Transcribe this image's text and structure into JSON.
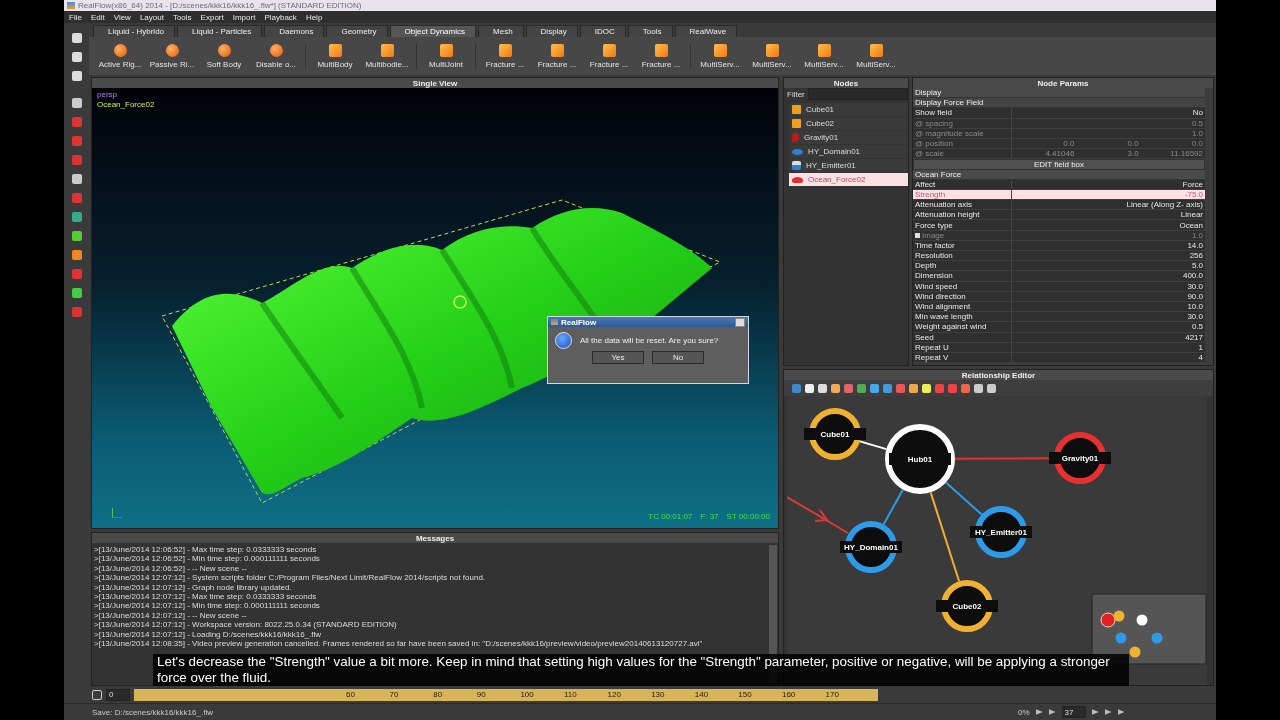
{
  "window": {
    "title": "RealFlow(x86_64) 2014 - [D:/scenes/kkk16/kkk16_.flw*] (STANDARD EDITION)"
  },
  "menu": [
    "File",
    "Edit",
    "View",
    "Layout",
    "Tools",
    "Export",
    "Import",
    "Playback",
    "Help"
  ],
  "shelf_tabs": [
    {
      "label": "Liquid - Hybrido",
      "selected": false
    },
    {
      "label": "Liquid - Particles",
      "selected": false
    },
    {
      "label": "Daemons",
      "selected": false
    },
    {
      "label": "Geometry",
      "selected": false
    },
    {
      "label": "Object Dynamics",
      "selected": true
    },
    {
      "label": "Mesh",
      "selected": false
    },
    {
      "label": "Display",
      "selected": false
    },
    {
      "label": "IDOC",
      "selected": false
    },
    {
      "label": "Tools",
      "selected": false
    },
    {
      "label": "RealWave",
      "selected": false
    }
  ],
  "shelf_groups": [
    [
      "Active Rig...",
      "Passive Ri...",
      "Soft Body",
      "Disable o..."
    ],
    [
      "MultiBody",
      "Multibodie..."
    ],
    [
      "MultiJoint"
    ],
    [
      "Fracture ...",
      "Fracture ...",
      "Fracture ...",
      "Fracture ..."
    ],
    [
      "MultiServ...",
      "MultiServ...",
      "MultiServ...",
      "MultiServ..."
    ]
  ],
  "viewport": {
    "title": "Single View",
    "camera": "persp",
    "object": "Ocean_Force02",
    "timecode": "TC 00:01:07",
    "frame": "F: 37",
    "sim_time": "ST 00:00:00"
  },
  "dialog": {
    "title": "RealFlow",
    "message": "All the data will be reset. Are you sure?",
    "buttons": [
      "Yes",
      "No"
    ]
  },
  "messages": {
    "title": "Messages",
    "lines": [
      ">[13/June/2014 12:06:52] - Max time step: 0.0333333 seconds",
      ">[13/June/2014 12:06:52] - Min time step: 0.000111111 seconds",
      ">[13/June/2014 12:06:52] - -- New scene --",
      ">[13/June/2014 12:07:12] - System scripts folder C:/Program Files/Next Limit/RealFlow 2014/scripts not found.",
      ">[13/June/2014 12:07:12] - Graph node library updated.",
      ">[13/June/2014 12:07:12] - Max time step: 0.0333333 seconds",
      ">[13/June/2014 12:07:12] - Min time step: 0.000111111 seconds",
      ">[13/June/2014 12:07:12] - -- New scene --",
      ">[13/June/2014 12:07:12] - Workspace version: 8022.25.0.34 (STANDARD EDITION)",
      ">[13/June/2014 12:07:12] -  Loading D:/scenes/kkk16/kkk16_.flw",
      ">[13/June/2014 12:08:35] - Video preview generation cancelled. Frames rendered so far have been saved in: \"D:/scenes/kkk16/preview/video/preview20140613120727.avi\""
    ]
  },
  "nodes": {
    "title": "Nodes",
    "filter_label": "Filter",
    "items": [
      {
        "name": "Cube01",
        "kind": "cube",
        "selected": false
      },
      {
        "name": "Cube02",
        "kind": "cube",
        "selected": false
      },
      {
        "name": "Gravity01",
        "kind": "gravity",
        "selected": false
      },
      {
        "name": "HY_Domain01",
        "kind": "domain",
        "selected": false
      },
      {
        "name": "HY_Emitter01",
        "kind": "emitter",
        "selected": false
      },
      {
        "name": "Ocean_Force02",
        "kind": "ocean",
        "selected": true
      }
    ]
  },
  "node_params": {
    "title": "Node Params",
    "rows": [
      {
        "kind": "section",
        "label": "Display"
      },
      {
        "kind": "subsection",
        "label": "Display Force Field"
      },
      {
        "kind": "param",
        "label": "Show field",
        "values": [
          "No"
        ],
        "disabled": false,
        "selected": false
      },
      {
        "kind": "param",
        "label": "@ spacing",
        "values": [
          "0.5"
        ],
        "disabled": true,
        "selected": false
      },
      {
        "kind": "param",
        "label": "@ magnitude scale",
        "values": [
          "1.0"
        ],
        "disabled": true,
        "selected": false
      },
      {
        "kind": "param",
        "label": "@ position",
        "values": [
          "0.0",
          "0.0",
          "0.0"
        ],
        "disabled": true,
        "selected": false
      },
      {
        "kind": "param",
        "label": "@ scale",
        "values": [
          "4.41046",
          "3.0",
          "11.16592"
        ],
        "disabled": true,
        "selected": false
      },
      {
        "kind": "button",
        "label": "EDIT field box"
      },
      {
        "kind": "section",
        "label": "Ocean Force"
      },
      {
        "kind": "param",
        "label": "Affect",
        "values": [
          "Force"
        ],
        "disabled": false,
        "selected": false
      },
      {
        "kind": "param",
        "label": "Strength",
        "values": [
          "-75.0"
        ],
        "disabled": false,
        "selected": true
      },
      {
        "kind": "param",
        "label": "Attenuation axis",
        "values": [
          "Linear (Along Z- axis)"
        ],
        "disabled": false,
        "selected": false
      },
      {
        "kind": "param",
        "label": "Attenuation height",
        "values": [
          "Linear"
        ],
        "disabled": false,
        "selected": false
      },
      {
        "kind": "param",
        "label": "Force type",
        "values": [
          "Ocean"
        ],
        "disabled": false,
        "selected": false
      },
      {
        "kind": "image_param",
        "label": "Image",
        "values": [
          "1.0"
        ],
        "disabled": true,
        "selected": false
      },
      {
        "kind": "param",
        "label": "Time factor",
        "values": [
          "14.0"
        ],
        "disabled": false,
        "selected": false
      },
      {
        "kind": "param",
        "label": "Resolution",
        "values": [
          "256"
        ],
        "disabled": false,
        "selected": false
      },
      {
        "kind": "param",
        "label": "Depth",
        "values": [
          "5.0"
        ],
        "disabled": false,
        "selected": false
      },
      {
        "kind": "param",
        "label": "Dimension",
        "values": [
          "400.0"
        ],
        "disabled": false,
        "selected": false
      },
      {
        "kind": "param",
        "label": "Wind speed",
        "values": [
          "30.0"
        ],
        "disabled": false,
        "selected": false
      },
      {
        "kind": "param",
        "label": "Wind direction",
        "values": [
          "90.0"
        ],
        "disabled": false,
        "selected": false
      },
      {
        "kind": "param",
        "label": "Wind alignment",
        "values": [
          "10.0"
        ],
        "disabled": false,
        "selected": false
      },
      {
        "kind": "param",
        "label": "Min wave length",
        "values": [
          "30.0"
        ],
        "disabled": false,
        "selected": false
      },
      {
        "kind": "param",
        "label": "Weight against wind",
        "values": [
          "0.5"
        ],
        "disabled": false,
        "selected": false
      },
      {
        "kind": "param",
        "label": "Seed",
        "values": [
          "4217"
        ],
        "disabled": false,
        "selected": false
      },
      {
        "kind": "param",
        "label": "Repeat U",
        "values": [
          "1"
        ],
        "disabled": false,
        "selected": false
      },
      {
        "kind": "param",
        "label": "Repeat V",
        "values": [
          "4"
        ],
        "disabled": false,
        "selected": false
      }
    ]
  },
  "relationship_editor": {
    "title": "Relationship Editor",
    "nodes": [
      {
        "name": "Cube01",
        "color": "#f0b030"
      },
      {
        "name": "Hub01",
        "color": "#ffffff"
      },
      {
        "name": "Gravity01",
        "color": "#e83030"
      },
      {
        "name": "HY_Domain01",
        "color": "#2e9be8"
      },
      {
        "name": "HY_Emitter01",
        "color": "#2e9be8"
      },
      {
        "name": "Cube02",
        "color": "#f0b030"
      }
    ]
  },
  "timeline": {
    "frame": "0",
    "ticks": [
      "60",
      "70",
      "80",
      "90",
      "100",
      "110",
      "120",
      "130",
      "140",
      "150",
      "160",
      "170"
    ]
  },
  "status_bar": {
    "message": "Save: D:/scenes/kkk16/kkk16_.flw",
    "progress": "0%",
    "frame": "37"
  },
  "subtitle": "Let's decrease the \"Strength\" value a bit more. Keep in mind that setting high values for the \"Strength\" parameter, positive or negative, will be applying a stronger force over the fluid."
}
